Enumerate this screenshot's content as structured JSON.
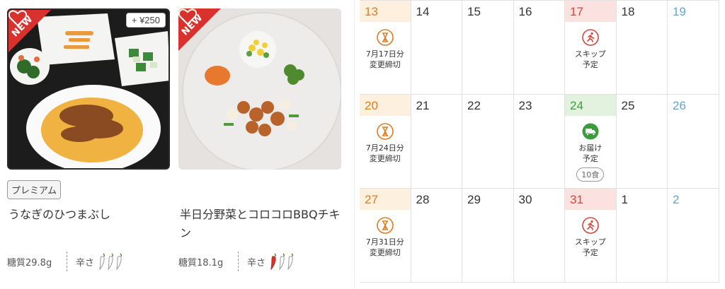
{
  "menu": {
    "items": [
      {
        "new_badge": "NEW",
        "price_badge": "+ ¥250",
        "tag": "プレミアム",
        "title": "うなぎのひつまぶし",
        "sugar": "糖質29.8g",
        "spicy_label": "辛さ",
        "spicy_level": 0,
        "spicy_max": 3
      },
      {
        "new_badge": "NEW",
        "title": "半日分野菜とコロコロBBQチキン",
        "sugar": "糖質18.1g",
        "spicy_label": "辛さ",
        "spicy_level": 1,
        "spicy_max": 3
      }
    ]
  },
  "calendar": {
    "colors": {
      "sat": "#5fa6d6",
      "deadline": "#e07b22",
      "skip": "#d9443a",
      "delivery": "#3c9b3a"
    },
    "weeks": [
      {
        "days": [
          {
            "num": "13",
            "style": "hl-orange",
            "event": {
              "icon": "hourglass-icon",
              "label": "7月17日分\n変更締切"
            }
          },
          {
            "num": "14"
          },
          {
            "num": "15"
          },
          {
            "num": "16"
          },
          {
            "num": "17",
            "style": "hl-red",
            "event": {
              "icon": "runner-icon",
              "label": "スキップ\n予定"
            }
          },
          {
            "num": "18"
          },
          {
            "num": "19",
            "style": "sat"
          }
        ]
      },
      {
        "days": [
          {
            "num": "20",
            "style": "hl-orange",
            "event": {
              "icon": "hourglass-icon",
              "label": "7月24日分\n変更締切"
            }
          },
          {
            "num": "21"
          },
          {
            "num": "22"
          },
          {
            "num": "23"
          },
          {
            "num": "24",
            "style": "hl-green",
            "event": {
              "icon": "truck-icon",
              "label": "お届け\n予定",
              "count": "10食"
            }
          },
          {
            "num": "25"
          },
          {
            "num": "26",
            "style": "sat"
          }
        ]
      },
      {
        "days": [
          {
            "num": "27",
            "style": "hl-orange",
            "event": {
              "icon": "hourglass-icon",
              "label": "7月31日分\n変更締切"
            }
          },
          {
            "num": "28"
          },
          {
            "num": "29"
          },
          {
            "num": "30"
          },
          {
            "num": "31",
            "style": "hl-red",
            "event": {
              "icon": "runner-icon",
              "label": "スキップ\n予定"
            }
          },
          {
            "num": "1"
          },
          {
            "num": "2",
            "style": "sat"
          }
        ]
      }
    ]
  }
}
